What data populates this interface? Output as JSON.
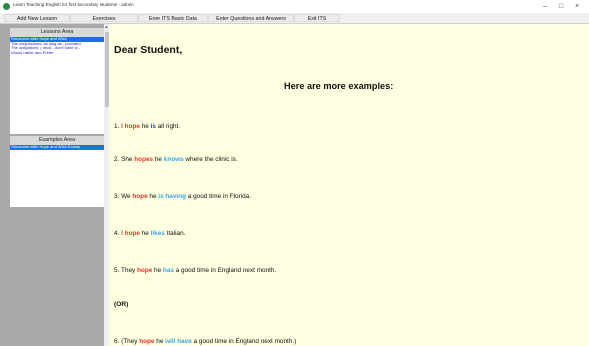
{
  "window": {
    "title": "Learn Teaching English for first secondary students - admin",
    "minimize": "–",
    "maximize": "□",
    "close": "×"
  },
  "menu": [
    "Add New Lesson",
    "Exercises",
    "Ener ITS Basic Data",
    "Enter Questions and Answers",
    "Exit ITS"
  ],
  "sidebar": {
    "lessons_header": "Lessons Area",
    "lessons": [
      "Structures after Hope and Wish",
      "The conjunctions: as long as - provided",
      "The obligations: ( must - don't have to -",
      "Would rather and Prefer"
    ],
    "examples_header": "Examples Area",
    "examples": [
      "Structures after Hope and Wish Examp"
    ]
  },
  "content": {
    "greeting": "Dear Student,",
    "heading": "Here are more examples:",
    "examples": [
      {
        "n": "1. I ",
        "v1": "hope",
        "mid": " he ",
        "v2": "is",
        "tail": " all right."
      },
      {
        "n": "2. She ",
        "v1": "hopes",
        "mid": " he ",
        "v2": "knows",
        "tail": " where the clinic is."
      },
      {
        "n": "3. We ",
        "v1": "hope",
        "mid": " he ",
        "v2": "is having",
        "tail": " a good time in Florida."
      },
      {
        "n": "4. I ",
        "v1": "hope",
        "mid": " he ",
        "v2": "likes",
        "tail": " Italian."
      },
      {
        "n": "5. They ",
        "v1": "hope",
        "mid": " he ",
        "v2": "has",
        "tail": " a good time in England next month."
      },
      {
        "n": "6. (They ",
        "v1": "hope",
        "mid": " he ",
        "v2": "will have",
        "tail": " a good time in England next month.)"
      }
    ],
    "or_label": "(OR)"
  },
  "colors": {
    "hope": "#e6332a",
    "verb": "#3aa6e8",
    "is": "#1b43c9",
    "selected": "#1e6fe0"
  }
}
